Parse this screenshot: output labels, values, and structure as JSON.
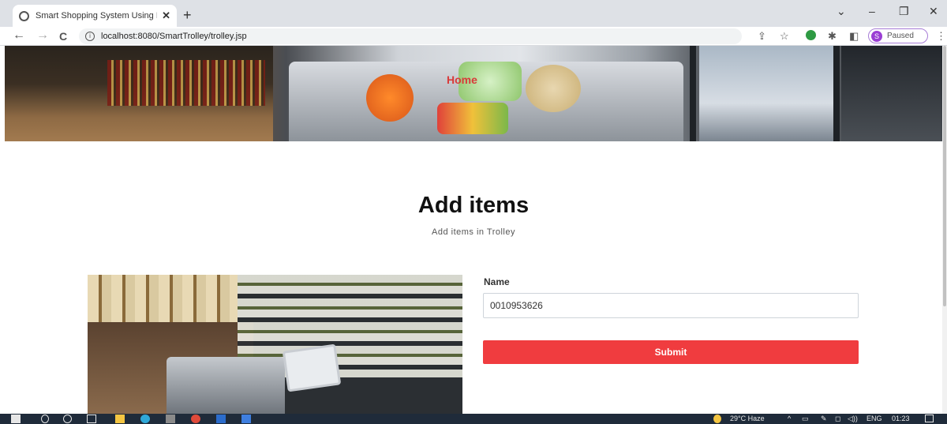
{
  "browser": {
    "tab_title": "Smart Shopping System Using R",
    "tab_close": "✕",
    "new_tab": "+",
    "url": "localhost:8080/SmartTrolley/trolley.jsp",
    "profile_initial": "S",
    "profile_status": "Paused",
    "controls": {
      "tab_search": "⌄",
      "minimize": "–",
      "restore": "❐",
      "close": "✕"
    },
    "nav": {
      "back": "←",
      "forward": "→",
      "reload": "C"
    }
  },
  "page": {
    "nav_home": "Home",
    "heading": "Add items",
    "subheading": "Add items in Trolley",
    "form": {
      "name_label": "Name",
      "name_value": "0010953626",
      "submit_label": "Submit"
    }
  },
  "taskbar": {
    "weather": "29°C  Haze",
    "language": "ENG",
    "time": "01:23"
  }
}
